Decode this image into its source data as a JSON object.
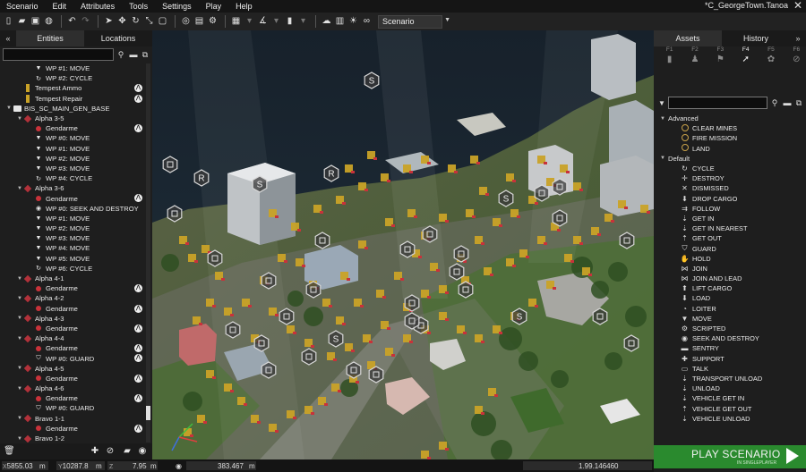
{
  "menu": [
    "Scenario",
    "Edit",
    "Attributes",
    "Tools",
    "Settings",
    "Play",
    "Help"
  ],
  "window_title": "*C_GeorgeTown.Tanoa",
  "toolbar": {
    "mode_label": "Scenario"
  },
  "left_panel": {
    "tabs": [
      "Entities",
      "Locations"
    ],
    "collapse": "«",
    "tree": [
      {
        "indent": 2,
        "toggle": "",
        "icon": "waypoint",
        "label": "WP #1: MOVE"
      },
      {
        "indent": 2,
        "toggle": "",
        "icon": "cycle",
        "label": "WP #2: CYCLE"
      },
      {
        "indent": 1,
        "toggle": "",
        "icon": "object",
        "label": "Tempest Ammo",
        "badge": true
      },
      {
        "indent": 1,
        "toggle": "",
        "icon": "object",
        "label": "Tempest Repair",
        "badge": true
      },
      {
        "indent": 0,
        "toggle": "▼",
        "icon": "folder",
        "label": "BIS_SC_MAIN_GEN_BASE"
      },
      {
        "indent": 1,
        "toggle": "▼",
        "icon": "group",
        "label": "Alpha 3-5"
      },
      {
        "indent": 2,
        "toggle": "",
        "icon": "unit",
        "label": "Gendarme",
        "badge": true
      },
      {
        "indent": 2,
        "toggle": "",
        "icon": "waypoint",
        "label": "WP #0: MOVE"
      },
      {
        "indent": 2,
        "toggle": "",
        "icon": "waypoint",
        "label": "WP #1: MOVE"
      },
      {
        "indent": 2,
        "toggle": "",
        "icon": "waypoint",
        "label": "WP #2: MOVE"
      },
      {
        "indent": 2,
        "toggle": "",
        "icon": "waypoint",
        "label": "WP #3: MOVE"
      },
      {
        "indent": 2,
        "toggle": "",
        "icon": "cycle",
        "label": "WP #4: CYCLE"
      },
      {
        "indent": 1,
        "toggle": "▼",
        "icon": "group",
        "label": "Alpha 3-6"
      },
      {
        "indent": 2,
        "toggle": "",
        "icon": "unit",
        "label": "Gendarme",
        "badge": true
      },
      {
        "indent": 2,
        "toggle": "",
        "icon": "seek",
        "label": "WP #0: SEEK AND DESTROY"
      },
      {
        "indent": 2,
        "toggle": "",
        "icon": "waypoint",
        "label": "WP #1: MOVE"
      },
      {
        "indent": 2,
        "toggle": "",
        "icon": "waypoint",
        "label": "WP #2: MOVE"
      },
      {
        "indent": 2,
        "toggle": "",
        "icon": "waypoint",
        "label": "WP #3: MOVE"
      },
      {
        "indent": 2,
        "toggle": "",
        "icon": "waypoint",
        "label": "WP #4: MOVE"
      },
      {
        "indent": 2,
        "toggle": "",
        "icon": "waypoint",
        "label": "WP #5: MOVE"
      },
      {
        "indent": 2,
        "toggle": "",
        "icon": "cycle",
        "label": "WP #6: CYCLE"
      },
      {
        "indent": 1,
        "toggle": "▼",
        "icon": "group",
        "label": "Alpha 4-1"
      },
      {
        "indent": 2,
        "toggle": "",
        "icon": "unit",
        "label": "Gendarme",
        "badge": true
      },
      {
        "indent": 1,
        "toggle": "▼",
        "icon": "group",
        "label": "Alpha 4-2"
      },
      {
        "indent": 2,
        "toggle": "",
        "icon": "unit",
        "label": "Gendarme",
        "badge": true
      },
      {
        "indent": 1,
        "toggle": "▼",
        "icon": "group",
        "label": "Alpha 4-3"
      },
      {
        "indent": 2,
        "toggle": "",
        "icon": "unit",
        "label": "Gendarme",
        "badge": true
      },
      {
        "indent": 1,
        "toggle": "▼",
        "icon": "group",
        "label": "Alpha 4-4"
      },
      {
        "indent": 2,
        "toggle": "",
        "icon": "unit",
        "label": "Gendarme",
        "badge": true
      },
      {
        "indent": 2,
        "toggle": "",
        "icon": "guard",
        "label": "WP #0: GUARD",
        "badge": true
      },
      {
        "indent": 1,
        "toggle": "▼",
        "icon": "group",
        "label": "Alpha 4-5"
      },
      {
        "indent": 2,
        "toggle": "",
        "icon": "unit",
        "label": "Gendarme",
        "badge": true
      },
      {
        "indent": 1,
        "toggle": "▼",
        "icon": "group",
        "label": "Alpha 4-6"
      },
      {
        "indent": 2,
        "toggle": "",
        "icon": "unit",
        "label": "Gendarme",
        "badge": true
      },
      {
        "indent": 2,
        "toggle": "",
        "icon": "guard",
        "label": "WP #0: GUARD"
      },
      {
        "indent": 1,
        "toggle": "▼",
        "icon": "group",
        "label": "Bravo 1-1"
      },
      {
        "indent": 2,
        "toggle": "",
        "icon": "unit",
        "label": "Gendarme",
        "badge": true
      },
      {
        "indent": 1,
        "toggle": "▼",
        "icon": "group",
        "label": "Bravo 1-2"
      }
    ],
    "badge_glyph": "⋀"
  },
  "right_panel": {
    "tabs": [
      "Assets",
      "History"
    ],
    "collapse": "»",
    "factions": [
      {
        "key": "F1",
        "icon": "▮"
      },
      {
        "key": "F2",
        "icon": "♟"
      },
      {
        "key": "F3",
        "icon": "⚑"
      },
      {
        "key": "F4",
        "icon": "➚"
      },
      {
        "key": "F5",
        "icon": "✿"
      },
      {
        "key": "F6",
        "icon": "⊘"
      }
    ],
    "active_faction": 3,
    "groups": [
      {
        "label": "Advanced",
        "items": [
          {
            "icon": "circle",
            "label": "CLEAR MINES"
          },
          {
            "icon": "circle",
            "label": "FIRE MISSION"
          },
          {
            "icon": "circle",
            "label": "LAND"
          }
        ]
      },
      {
        "label": "Default",
        "items": [
          {
            "icon": "↻",
            "label": "CYCLE"
          },
          {
            "icon": "✛",
            "label": "DESTROY"
          },
          {
            "icon": "✕",
            "label": "DISMISSED"
          },
          {
            "icon": "⬇",
            "label": "DROP CARGO"
          },
          {
            "icon": "⇉",
            "label": "FOLLOW"
          },
          {
            "icon": "⇣",
            "label": "GET IN"
          },
          {
            "icon": "⇣",
            "label": "GET IN NEAREST"
          },
          {
            "icon": "⇡",
            "label": "GET OUT"
          },
          {
            "icon": "⛉",
            "label": "GUARD"
          },
          {
            "icon": "✋",
            "label": "HOLD"
          },
          {
            "icon": "⋈",
            "label": "JOIN"
          },
          {
            "icon": "⋈",
            "label": "JOIN AND LEAD"
          },
          {
            "icon": "⬆",
            "label": "LIFT CARGO"
          },
          {
            "icon": "⬇",
            "label": "LOAD"
          },
          {
            "icon": "◔",
            "label": "LOITER"
          },
          {
            "icon": "▼",
            "label": "MOVE"
          },
          {
            "icon": "⚙",
            "label": "SCRIPTED"
          },
          {
            "icon": "◉",
            "label": "SEEK AND DESTROY"
          },
          {
            "icon": "▬",
            "label": "SENTRY"
          },
          {
            "icon": "✚",
            "label": "SUPPORT"
          },
          {
            "icon": "▭",
            "label": "TALK"
          },
          {
            "icon": "⇣",
            "label": "TRANSPORT UNLOAD"
          },
          {
            "icon": "⇣",
            "label": "UNLOAD"
          },
          {
            "icon": "⇣",
            "label": "VEHICLE GET IN"
          },
          {
            "icon": "⇡",
            "label": "VEHICLE GET OUT"
          },
          {
            "icon": "⇣",
            "label": "VEHICLE UNLOAD"
          }
        ]
      }
    ]
  },
  "play_button": {
    "label": "PLAY SCENARIO",
    "sub": "IN SINGLEPLAYER"
  },
  "status": {
    "x_label": "X",
    "x": "5855.03",
    "x_unit": "m",
    "y_label": "Y",
    "y": "10287.8",
    "y_unit": "m",
    "z_label": "Z",
    "z": "7.95",
    "z_unit": "m",
    "dist": "383.467",
    "dist_unit": "m",
    "zoom": "1.99.146460"
  },
  "map_markers": {
    "letters": [
      "S",
      "R"
    ]
  },
  "colors": {
    "accent_play": "#2a8a2e",
    "unit_marker": "#c9a227",
    "group_red": "#b2313a"
  }
}
